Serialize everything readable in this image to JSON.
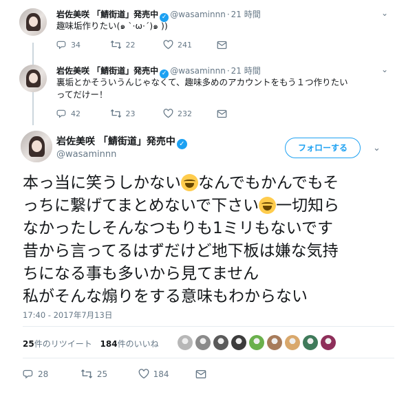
{
  "tweets": [
    {
      "name": "岩佐美咲 「鯖街道」発売中",
      "handle": "@wasaminnn",
      "time": "21 時間",
      "text": "趣味垢作りたい(๑ `·ω·´)๑ ))",
      "replies": "34",
      "retweets": "22",
      "likes": "241"
    },
    {
      "name": "岩佐美咲 「鯖街道」発売中",
      "handle": "@wasaminnn",
      "time": "21 時間",
      "text_line1": "裏垢とかそういうんじゃなくて、趣味多めのアカウントをもう１つ作りたい",
      "text_line2": "ってだけー！",
      "replies": "42",
      "retweets": "23",
      "likes": "232"
    }
  ],
  "main": {
    "name": "岩佐美咲 「鯖街道」発売中",
    "handle": "@wasaminnn",
    "follow_label": "フォローする",
    "lines": [
      "本っ当に笑うしかない",
      "なんでもかんでもそ",
      "っちに繋げてまとめないで下さい",
      "一切知ら",
      "なかったしそんなつもりも1ミリもないです",
      "昔から言ってるはずだけど地下板は嫌な気持",
      "ちになる事も多いから見てません",
      "私がそんな煽りをする意味もわからない"
    ],
    "timestamp": "17:40 - 2017年7月13日",
    "retweet_count": "25",
    "retweet_label": "件のリツイート",
    "like_count": "184",
    "like_label": "件のいいね",
    "replies": "28",
    "retweets": "25",
    "likes": "184"
  },
  "colors": {
    "accent": "#1da1f2",
    "muted": "#657786",
    "liker_colors": [
      "#b7b7b7",
      "#8a8a8a",
      "#5a5a5a",
      "#3c3c3c",
      "#6ab04c",
      "#a77b5a",
      "#d9a86c",
      "#3f7a5a",
      "#8e2f5a"
    ]
  },
  "icons": [
    "reply-icon",
    "retweet-icon",
    "heart-icon",
    "dm-icon",
    "verified-icon",
    "chevron-down-icon"
  ]
}
